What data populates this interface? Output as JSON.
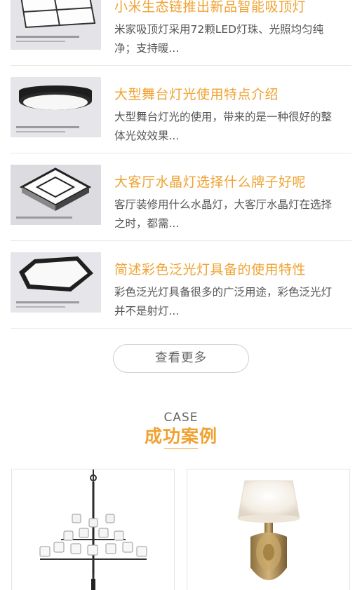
{
  "news": [
    {
      "title": "小米生态链推出新品智能吸顶灯",
      "desc": "米家吸顶灯采用72颗LED灯珠、光照均匀纯净；支持暖..."
    },
    {
      "title": "大型舞台灯光使用特点介绍",
      "desc": "大型舞台灯光的使用，带来的是一种很好的整体光效效果..."
    },
    {
      "title": "大客厅水晶灯选择什么牌子好呢",
      "desc": "客厅装修用什么水晶灯，大客厅水晶灯在选择之时，都需..."
    },
    {
      "title": "简述彩色泛光灯具备的使用特性",
      "desc": "彩色泛光灯具备很多的广泛用途，彩色泛光灯并不是射灯..."
    }
  ],
  "more_label": "查看更多",
  "cases": {
    "en": "CASE",
    "cn": "成功案例"
  },
  "colors": {
    "accent": "#f0a231",
    "text": "#555555",
    "border": "#e8e8e8"
  }
}
